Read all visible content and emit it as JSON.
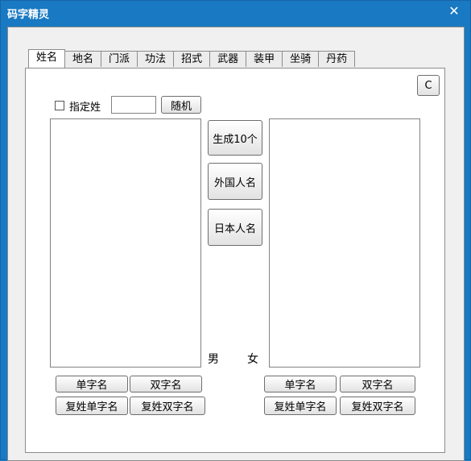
{
  "window": {
    "title": "码字精灵",
    "close_glyph": "✕"
  },
  "tabs": [
    {
      "label": "姓名",
      "active": true
    },
    {
      "label": "地名",
      "active": false
    },
    {
      "label": "门派",
      "active": false
    },
    {
      "label": "功法",
      "active": false
    },
    {
      "label": "招式",
      "active": false
    },
    {
      "label": "武器",
      "active": false
    },
    {
      "label": "装甲",
      "active": false
    },
    {
      "label": "坐骑",
      "active": false
    },
    {
      "label": "丹药",
      "active": false
    }
  ],
  "panel": {
    "c_button": "C",
    "specify_surname_label": "指定姓",
    "specify_surname_value": "",
    "random_button": "随机",
    "generate_button": "生成10个",
    "foreign_button": "外国人名",
    "japanese_button": "日本人名",
    "male_label": "男",
    "female_label": "女",
    "male_buttons": {
      "single": "单字名",
      "double": "双字名",
      "compound_single": "复姓单字名",
      "compound_double": "复姓双字名"
    },
    "female_buttons": {
      "single": "单字名",
      "double": "双字名",
      "compound_single": "复姓单字名",
      "compound_double": "复姓双字名"
    }
  }
}
